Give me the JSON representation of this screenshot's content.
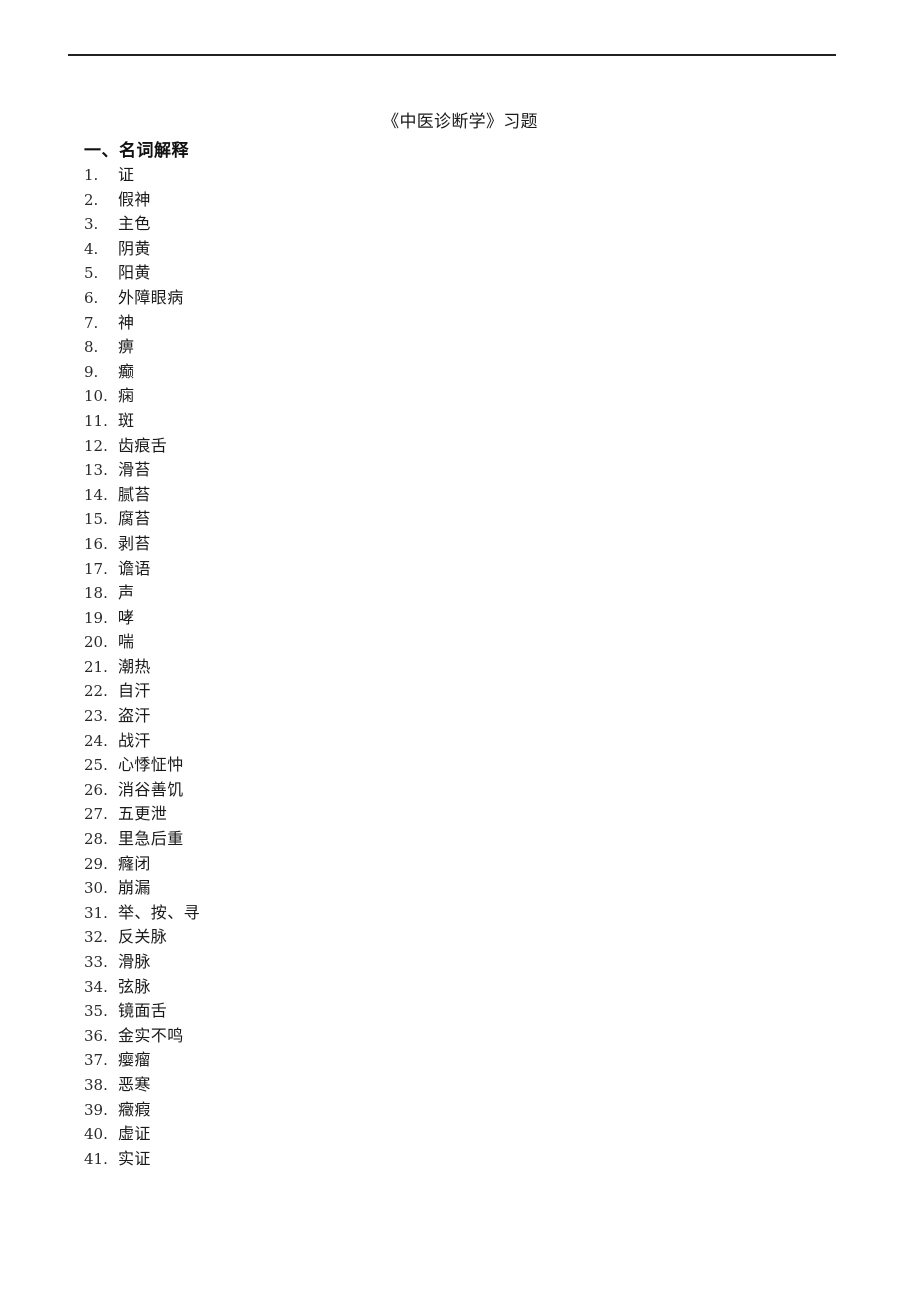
{
  "document": {
    "title": "《中医诊断学》习题",
    "header_rule": true
  },
  "sections": [
    {
      "heading": "一、名词解释",
      "items": [
        {
          "number": "1.",
          "term": "证"
        },
        {
          "number": "2.",
          "term": "假神"
        },
        {
          "number": "3.",
          "term": "主色"
        },
        {
          "number": "4.",
          "term": "阴黄"
        },
        {
          "number": "5.",
          "term": "阳黄"
        },
        {
          "number": "6.",
          "term": "外障眼病"
        },
        {
          "number": "7.",
          "term": "神"
        },
        {
          "number": "8.",
          "term": "痹"
        },
        {
          "number": "9.",
          "term": "癫"
        },
        {
          "number": "10.",
          "term": "痫"
        },
        {
          "number": "11.",
          "term": "斑"
        },
        {
          "number": "12.",
          "term": "齿痕舌"
        },
        {
          "number": "13.",
          "term": "滑苔"
        },
        {
          "number": "14.",
          "term": "腻苔"
        },
        {
          "number": "15.",
          "term": "腐苔"
        },
        {
          "number": "16.",
          "term": "剥苔"
        },
        {
          "number": "17.",
          "term": "谵语"
        },
        {
          "number": "18.",
          "term": "声"
        },
        {
          "number": "19.",
          "term": "哮"
        },
        {
          "number": "20.",
          "term": "喘"
        },
        {
          "number": "21.",
          "term": "潮热"
        },
        {
          "number": "22.",
          "term": "自汗"
        },
        {
          "number": "23.",
          "term": "盗汗"
        },
        {
          "number": "24.",
          "term": "战汗"
        },
        {
          "number": "25.",
          "term": "心悸怔忡"
        },
        {
          "number": "26.",
          "term": "消谷善饥"
        },
        {
          "number": "27.",
          "term": "五更泄"
        },
        {
          "number": "28.",
          "term": "里急后重"
        },
        {
          "number": "29.",
          "term": "癃闭"
        },
        {
          "number": "30.",
          "term": "崩漏"
        },
        {
          "number": "31.",
          "term": "举、按、寻"
        },
        {
          "number": "32.",
          "term": "反关脉"
        },
        {
          "number": "33.",
          "term": "滑脉"
        },
        {
          "number": "34.",
          "term": "弦脉"
        },
        {
          "number": "35.",
          "term": "镜面舌"
        },
        {
          "number": "36.",
          "term": "金实不鸣"
        },
        {
          "number": "37.",
          "term": "瘿瘤"
        },
        {
          "number": "38.",
          "term": "恶寒"
        },
        {
          "number": "39.",
          "term": "癥瘕"
        },
        {
          "number": "40.",
          "term": "虚证"
        },
        {
          "number": "41.",
          "term": "实证"
        }
      ]
    }
  ],
  "colors": {
    "text": "#1a1a1a",
    "rule": "#222222",
    "background": "#ffffff"
  }
}
